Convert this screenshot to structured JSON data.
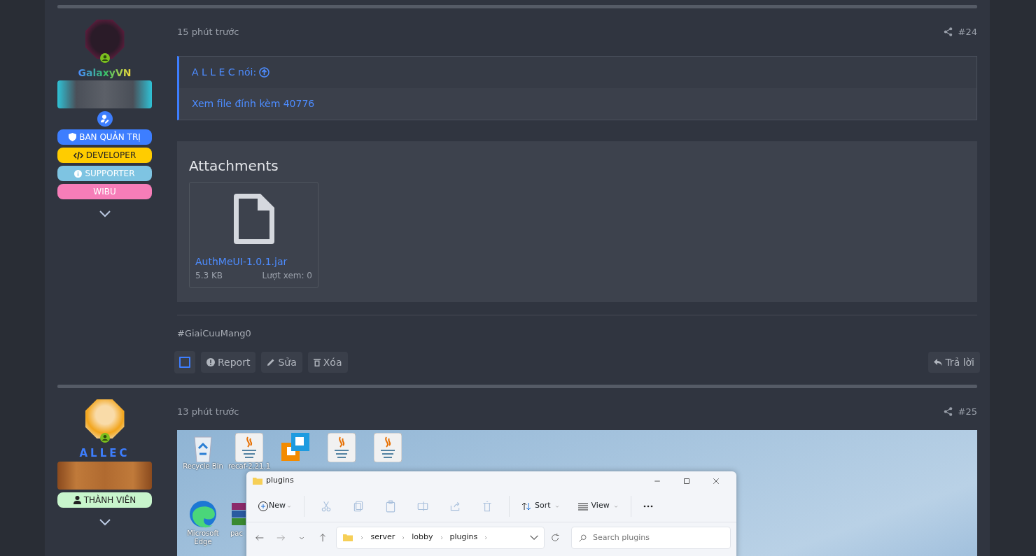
{
  "posts": [
    {
      "time": "15 phút trước",
      "number": "#24",
      "user": {
        "name": "GalaxyVN",
        "role_icon": true,
        "badges": [
          {
            "label": "BAN QUẢN TRỊ",
            "kind": "shield",
            "color": "#3d7eff"
          },
          {
            "label": "DEVELOPER",
            "kind": "code",
            "color": "#ffcc00"
          },
          {
            "label": "SUPPORTER",
            "kind": "info",
            "color": "#7ec4e2"
          },
          {
            "label": "WIBU",
            "color": "#f67db8"
          }
        ]
      },
      "quote": {
        "author": "A L L E C nói:",
        "link": "Xem file đính kèm 40776"
      },
      "attachments": {
        "title": "Attachments",
        "files": [
          {
            "name": "AuthMeUI-1.0.1.jar",
            "size": "5.3 KB",
            "views": "Lượt xem: 0"
          }
        ]
      },
      "signature": "#GiaiCuuMang0",
      "select": {
        "checked": false
      },
      "actions": [
        {
          "label": "Report",
          "kind": "report"
        },
        {
          "label": "Sửa",
          "kind": "edit"
        },
        {
          "label": "Xóa",
          "kind": "delete"
        }
      ],
      "reply": "Trả lời"
    },
    {
      "time": "13 phút trước",
      "number": "#25",
      "user": {
        "name": "ALLEC",
        "badges": [
          {
            "label": "THÀNH VIÊN",
            "kind": "user",
            "color": "#c8f5cc"
          }
        ]
      },
      "screenshot": {
        "desktop_icons": [
          [
            {
              "kind": "recycle",
              "label": "Recycle Bin"
            },
            {
              "kind": "java",
              "label": "recaf-2.21.1"
            },
            {
              "kind": "vmware"
            },
            {
              "kind": "java"
            },
            {
              "kind": "java"
            }
          ],
          [
            {
              "kind": "edge",
              "label": "Microsoft Edge"
            },
            {
              "kind": "archive",
              "label": "pac"
            }
          ]
        ],
        "window": {
          "title": "plugins",
          "new": "New",
          "tools": [
            {
              "kind": "cut",
              "disabled": true
            },
            {
              "kind": "copy",
              "disabled": true
            },
            {
              "kind": "paste",
              "disabled": true
            },
            {
              "kind": "rename",
              "disabled": true
            },
            {
              "kind": "share",
              "disabled": true
            },
            {
              "kind": "delete",
              "disabled": true
            }
          ],
          "sort": "Sort",
          "view": "View",
          "path": [
            "server",
            "lobby",
            "plugins"
          ],
          "search_placeholder": "Search plugins"
        }
      }
    }
  ]
}
